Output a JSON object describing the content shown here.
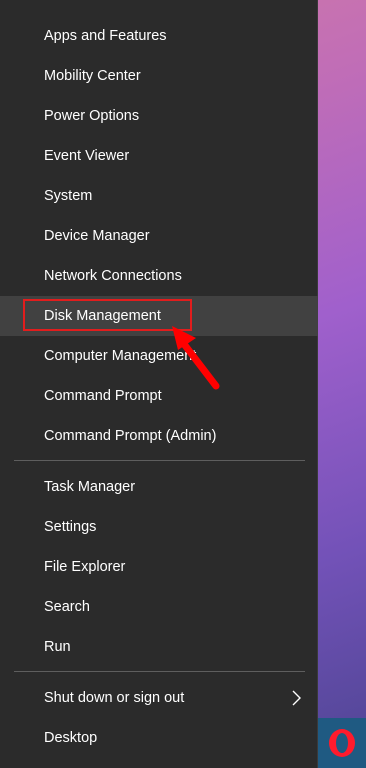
{
  "menu": {
    "groups": [
      {
        "items": [
          {
            "label": "Apps and Features"
          },
          {
            "label": "Mobility Center"
          },
          {
            "label": "Power Options"
          },
          {
            "label": "Event Viewer"
          },
          {
            "label": "System"
          },
          {
            "label": "Device Manager"
          },
          {
            "label": "Network Connections"
          },
          {
            "label": "Disk Management"
          },
          {
            "label": "Computer Management"
          },
          {
            "label": "Command Prompt"
          },
          {
            "label": "Command Prompt (Admin)"
          }
        ]
      },
      {
        "items": [
          {
            "label": "Task Manager"
          },
          {
            "label": "Settings"
          },
          {
            "label": "File Explorer"
          },
          {
            "label": "Search"
          },
          {
            "label": "Run"
          }
        ]
      },
      {
        "items": [
          {
            "label": "Shut down or sign out",
            "submenu_icon": "chevron-right-icon"
          },
          {
            "label": "Desktop"
          }
        ]
      }
    ],
    "hovered_item": "Disk Management"
  },
  "annotation": {
    "highlight_color": "#e21d1d",
    "arrow_color": "#ff0000"
  },
  "taskbar": {
    "pinned_icon": "opera-icon",
    "background_color": "#1f5a82"
  },
  "colors": {
    "menu_background": "#2b2b2b",
    "menu_text": "#ffffff",
    "hover_background": "#414141",
    "separator": "#5e5e5e"
  }
}
